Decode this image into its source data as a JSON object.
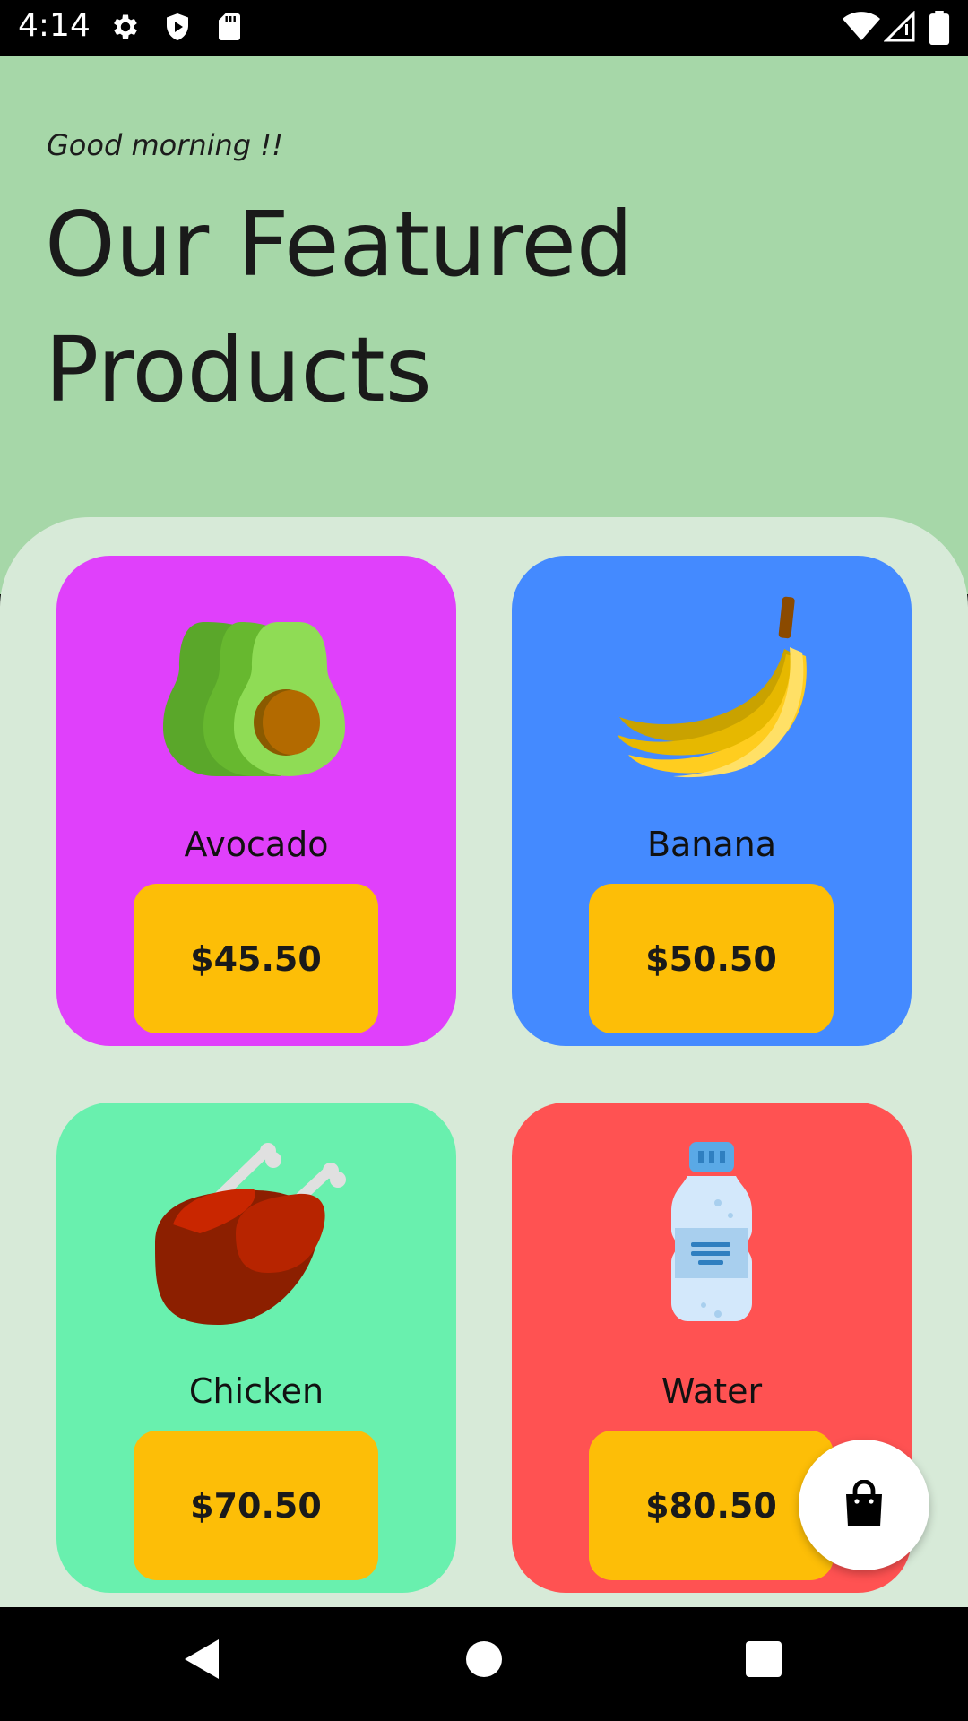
{
  "status_bar": {
    "time": "4:14",
    "icons": [
      "gear-icon",
      "play-shield-icon",
      "sd-card-icon",
      "wifi-icon",
      "signal-icon",
      "battery-icon"
    ]
  },
  "header": {
    "greeting": "Good morning !!",
    "title": "Our Featured Products",
    "background": "#a6d7a8"
  },
  "products": [
    {
      "name": "Avocado",
      "price": "$45.50",
      "color": "#e040fb",
      "icon": "avocado-icon"
    },
    {
      "name": "Banana",
      "price": "$50.50",
      "color": "#448aff",
      "icon": "banana-icon"
    },
    {
      "name": "Chicken",
      "price": "$70.50",
      "color": "#69f0ae",
      "icon": "chicken-icon"
    },
    {
      "name": "Water",
      "price": "$80.50",
      "color": "#ff5252",
      "icon": "water-bottle-icon"
    }
  ],
  "accent_colors": {
    "price_button": "#fdbe07",
    "sheet": "#d7ead8"
  },
  "fab": {
    "icon": "shopping-bag-icon"
  },
  "nav_bar": {
    "icons": [
      "back-icon",
      "home-icon",
      "recents-icon"
    ]
  }
}
